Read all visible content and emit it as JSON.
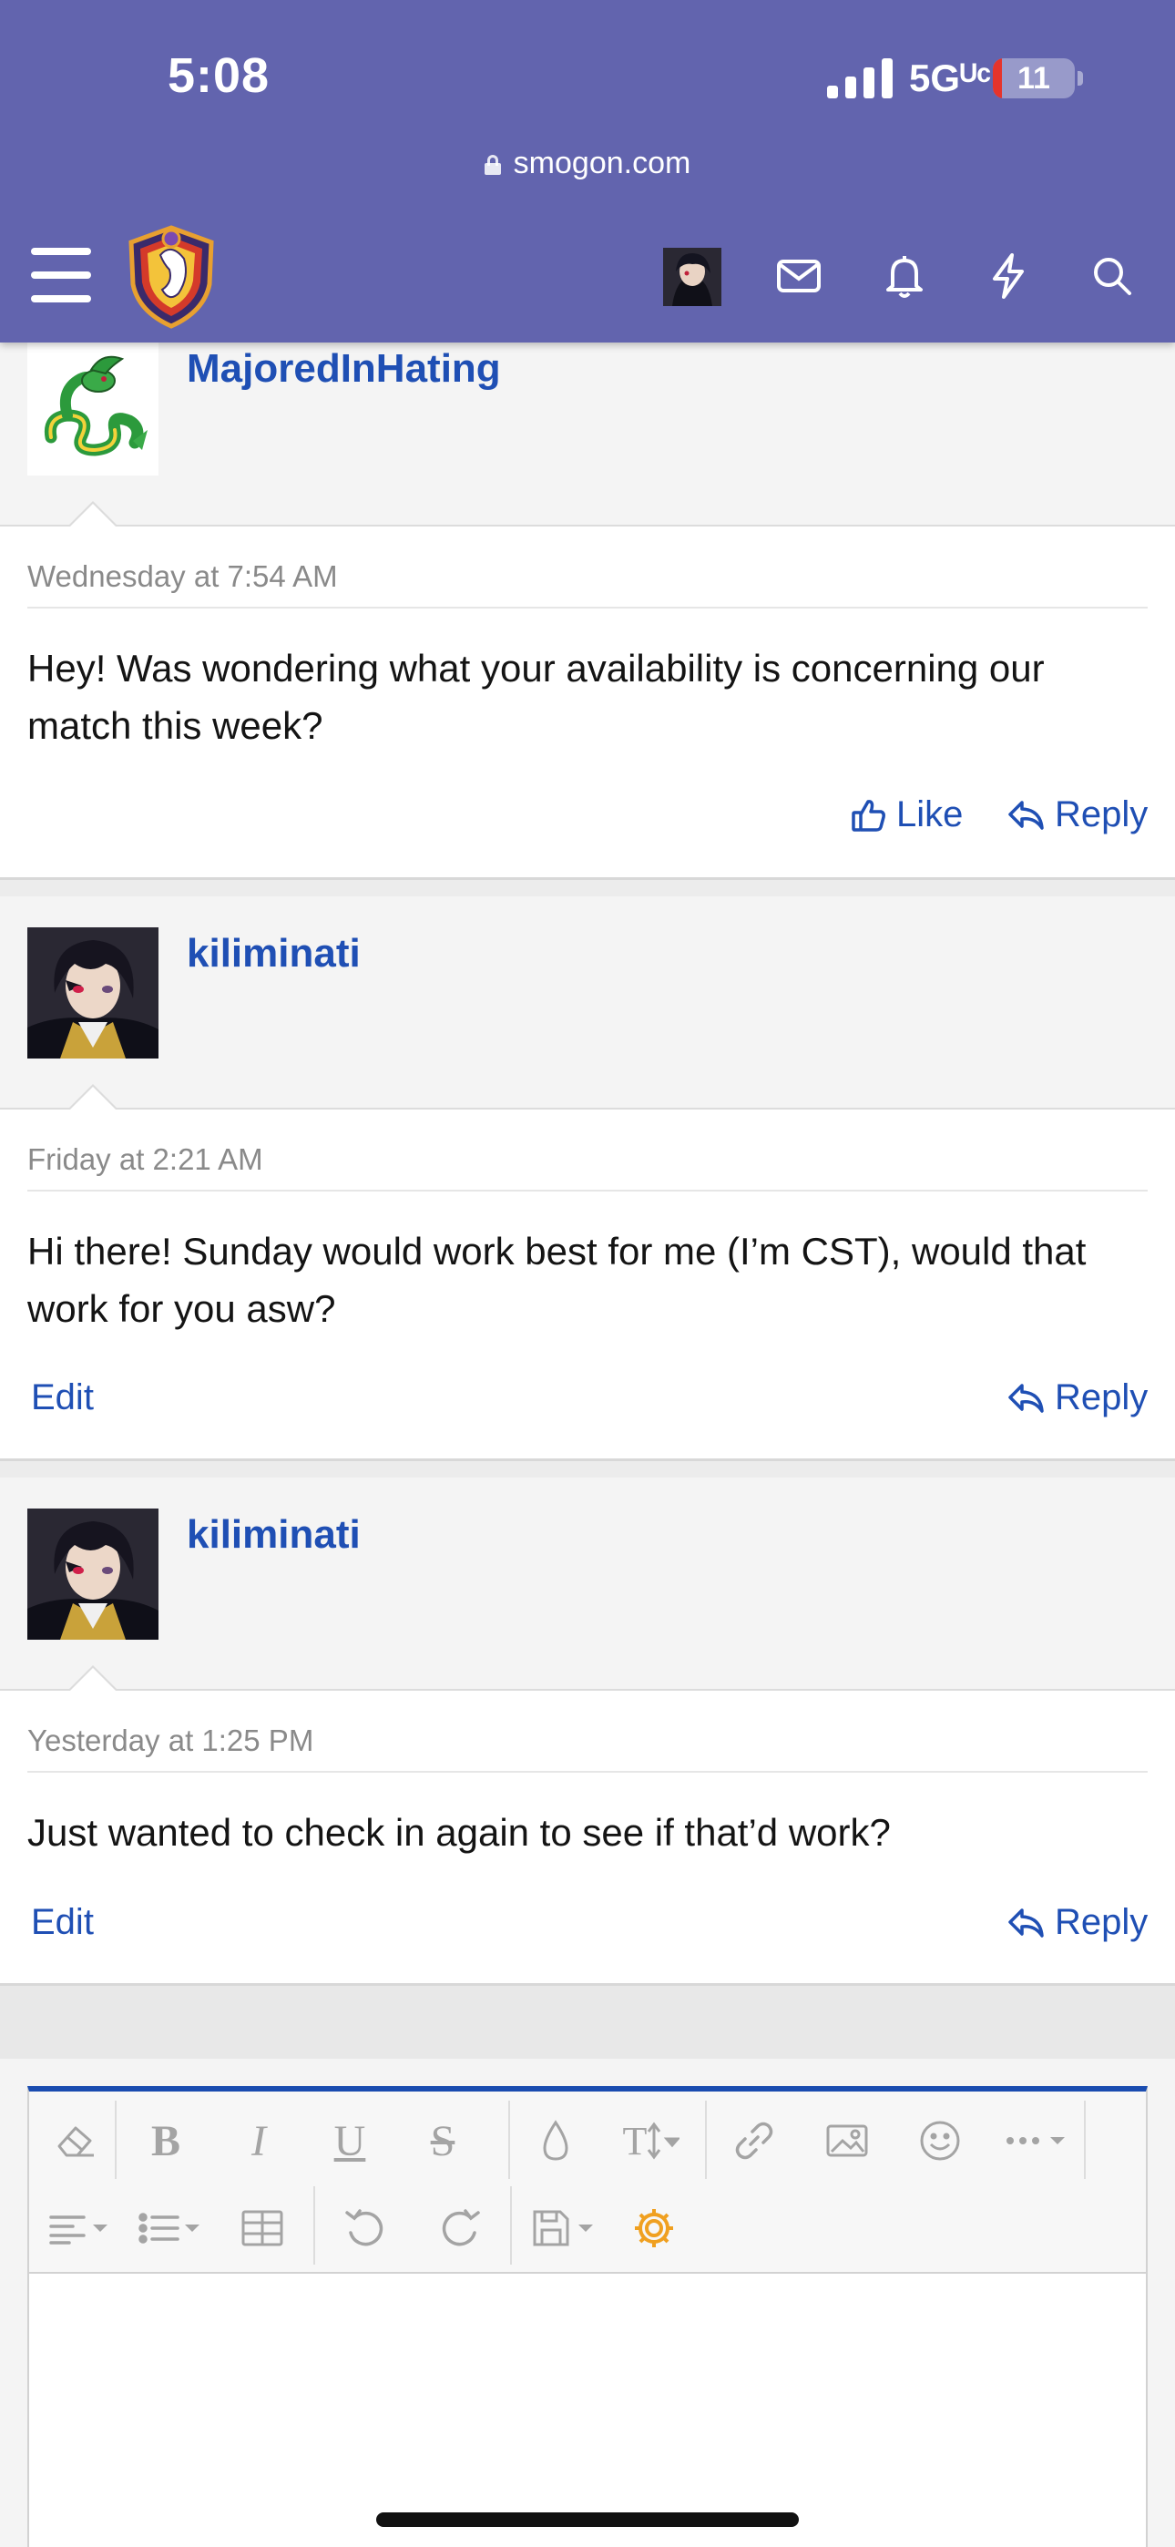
{
  "status_bar": {
    "time": "5:08",
    "network": "5Gᵁᶜ",
    "battery_level": "11",
    "battery_fraction": 0.11
  },
  "browser": {
    "url": "smogon.com"
  },
  "nav": {
    "icons": [
      "menu-icon",
      "site-logo",
      "user-avatar",
      "envelope-icon",
      "bell-icon",
      "lightning-icon",
      "search-icon"
    ]
  },
  "messages": [
    {
      "username": "MajoredInHating",
      "avatar": "serperior-sprite",
      "date": "Wednesday at 7:54 AM",
      "text": "Hey! Was wondering what your availability is concerning our match this week?",
      "like_label": "Like",
      "reply_label": "Reply"
    },
    {
      "username": "kiliminati",
      "avatar": "anime-character",
      "date": "Friday at 2:21 AM",
      "text": "Hi there! Sunday would work best for me (I’m CST), would that work for you asw?",
      "edit_label": "Edit",
      "reply_label": "Reply"
    },
    {
      "username": "kiliminati",
      "avatar": "anime-character",
      "date": "Yesterday at 1:25 PM",
      "text": "Just wanted to check in again to see if that’d work?",
      "edit_label": "Edit",
      "reply_label": "Reply"
    }
  ],
  "editor": {
    "toolbar_row1": [
      "eraser-icon",
      "bold-icon",
      "italic-icon",
      "underline-icon",
      "strikethrough-icon",
      "color-icon",
      "font-size-icon",
      "link-icon",
      "image-icon",
      "emoji-icon",
      "more-icon"
    ],
    "toolbar_row2": [
      "align-icon",
      "list-icon",
      "table-icon",
      "undo-icon",
      "redo-icon",
      "drafts-icon",
      "settings-icon"
    ],
    "toolbar_text": {
      "bold": "B",
      "italic": "I",
      "underline": "U",
      "strike": "S",
      "fontsize": "T"
    },
    "accent_color": "#1a4cb0",
    "settings_color": "#f0a020"
  },
  "colors": {
    "header": "#6264ae",
    "link": "#1f4fb4"
  }
}
